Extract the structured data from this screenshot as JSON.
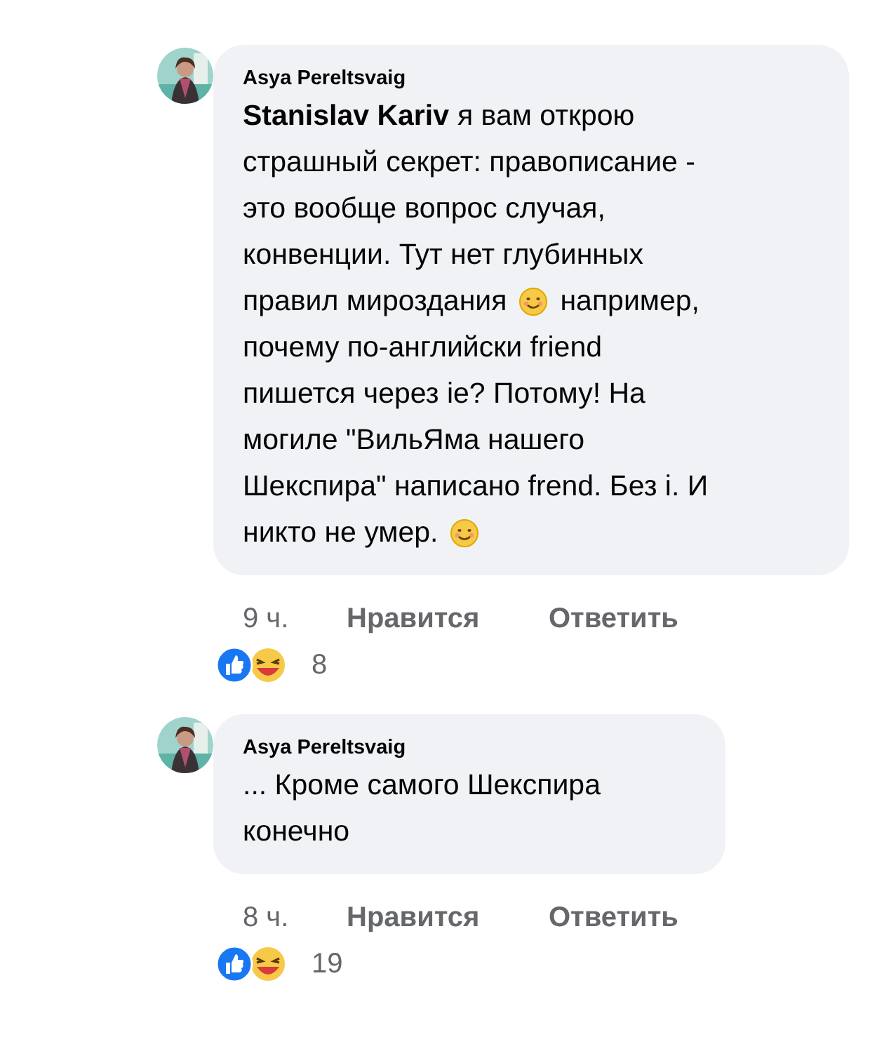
{
  "comments": [
    {
      "author": "Asya Pereltsvaig",
      "avatar": {
        "kind": "picture"
      },
      "lines": [
        [
          {
            "kind": "mention",
            "text": "Stanislav Kariv"
          },
          {
            "kind": "text",
            "text": "я вам открою"
          }
        ],
        [
          {
            "kind": "text",
            "text": "страшный секрет: правописание -"
          }
        ],
        [
          {
            "kind": "text",
            "text": "это вообще вопрос случая,"
          }
        ],
        [
          {
            "kind": "text",
            "text": "конвенции. Тут нет глубинных"
          }
        ],
        [
          {
            "kind": "text",
            "text": "правил мироздания"
          },
          {
            "kind": "emoji"
          },
          {
            "kind": "text",
            "text": "например,"
          }
        ],
        [
          {
            "kind": "text",
            "text": "почему по-английски friend"
          }
        ],
        [
          {
            "kind": "text",
            "text": "пишется через ie? Потому! На"
          }
        ],
        [
          {
            "kind": "text",
            "text": "могиле \"ВильЯма нашего"
          }
        ],
        [
          {
            "kind": "text",
            "text": "Шекспира\" написано frend. Без i. И"
          }
        ],
        [
          {
            "kind": "text",
            "text": "никто не умер."
          },
          {
            "kind": "emoji"
          }
        ]
      ],
      "time": "9 ч.",
      "like": "Нравится",
      "reply": "Ответить",
      "reaction_count": "8"
    },
    {
      "author": "Asya Pereltsvaig",
      "avatar": {
        "kind": "picture"
      },
      "lines": [
        [
          {
            "kind": "text",
            "text": "... Кроме самого Шекспира"
          }
        ],
        [
          {
            "kind": "text",
            "text": "конечно"
          }
        ]
      ],
      "time": "8 ч.",
      "like": "Нравится",
      "reply": "Ответить",
      "reaction_count": "19"
    }
  ]
}
